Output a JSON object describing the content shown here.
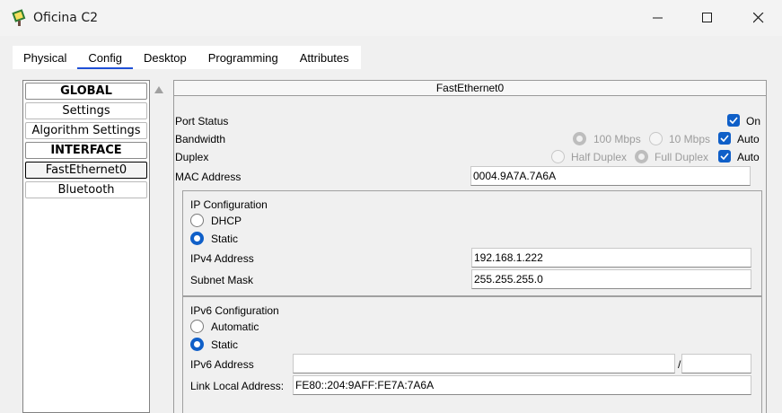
{
  "window": {
    "title": "Oficina C2"
  },
  "tabs": [
    "Physical",
    "Config",
    "Desktop",
    "Programming",
    "Attributes"
  ],
  "sidebar": {
    "items": [
      {
        "label": "GLOBAL",
        "type": "header"
      },
      {
        "label": "Settings",
        "type": "item"
      },
      {
        "label": "Algorithm Settings",
        "type": "item"
      },
      {
        "label": "INTERFACE",
        "type": "header"
      },
      {
        "label": "FastEthernet0",
        "type": "item",
        "selected": true
      },
      {
        "label": "Bluetooth",
        "type": "item"
      }
    ]
  },
  "panel": {
    "title": "FastEthernet0",
    "port_status": {
      "label": "Port Status",
      "on_label": "On",
      "checked": true
    },
    "bandwidth": {
      "label": "Bandwidth",
      "opt100": "100 Mbps",
      "opt10": "10 Mbps",
      "auto_label": "Auto"
    },
    "duplex": {
      "label": "Duplex",
      "half": "Half Duplex",
      "full": "Full Duplex",
      "auto_label": "Auto"
    },
    "mac": {
      "label": "MAC Address",
      "value": "0004.9A7A.7A6A"
    },
    "ipv4_config": {
      "title": "IP Configuration",
      "dhcp": "DHCP",
      "static": "Static",
      "ipv4_label": "IPv4 Address",
      "ipv4_value": "192.168.1.222",
      "mask_label": "Subnet Mask",
      "mask_value": "255.255.255.0"
    },
    "ipv6_config": {
      "title": "IPv6 Configuration",
      "automatic": "Automatic",
      "static": "Static",
      "ipv6_label": "IPv6 Address",
      "ipv6_value": "",
      "slash": "/",
      "prefix_value": "",
      "link_local_label": "Link Local Address:",
      "link_local_value": "FE80::204:9AFF:FE7A:7A6A"
    }
  },
  "colors": {
    "accent": "#0f5fc8",
    "tab_underline": "#1f4fd6"
  }
}
